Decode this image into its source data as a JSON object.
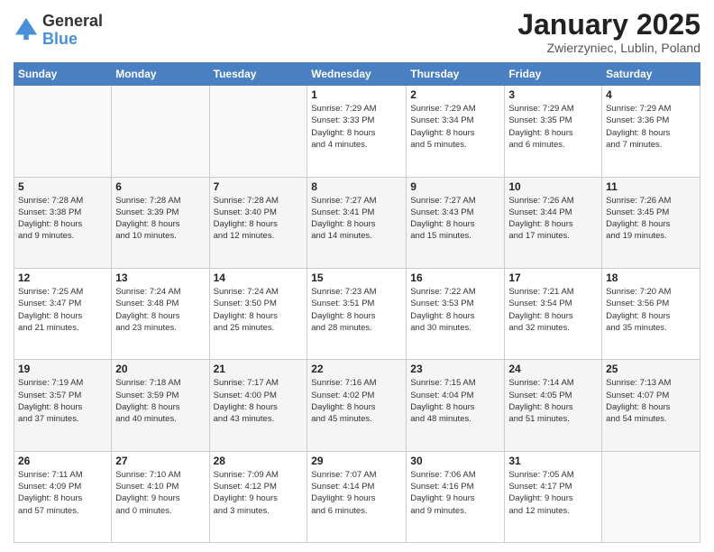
{
  "logo": {
    "general": "General",
    "blue": "Blue"
  },
  "header": {
    "title": "January 2025",
    "subtitle": "Zwierzyniec, Lublin, Poland"
  },
  "days": [
    "Sunday",
    "Monday",
    "Tuesday",
    "Wednesday",
    "Thursday",
    "Friday",
    "Saturday"
  ],
  "weeks": [
    [
      {
        "num": "",
        "info": ""
      },
      {
        "num": "",
        "info": ""
      },
      {
        "num": "",
        "info": ""
      },
      {
        "num": "1",
        "info": "Sunrise: 7:29 AM\nSunset: 3:33 PM\nDaylight: 8 hours\nand 4 minutes."
      },
      {
        "num": "2",
        "info": "Sunrise: 7:29 AM\nSunset: 3:34 PM\nDaylight: 8 hours\nand 5 minutes."
      },
      {
        "num": "3",
        "info": "Sunrise: 7:29 AM\nSunset: 3:35 PM\nDaylight: 8 hours\nand 6 minutes."
      },
      {
        "num": "4",
        "info": "Sunrise: 7:29 AM\nSunset: 3:36 PM\nDaylight: 8 hours\nand 7 minutes."
      }
    ],
    [
      {
        "num": "5",
        "info": "Sunrise: 7:28 AM\nSunset: 3:38 PM\nDaylight: 8 hours\nand 9 minutes."
      },
      {
        "num": "6",
        "info": "Sunrise: 7:28 AM\nSunset: 3:39 PM\nDaylight: 8 hours\nand 10 minutes."
      },
      {
        "num": "7",
        "info": "Sunrise: 7:28 AM\nSunset: 3:40 PM\nDaylight: 8 hours\nand 12 minutes."
      },
      {
        "num": "8",
        "info": "Sunrise: 7:27 AM\nSunset: 3:41 PM\nDaylight: 8 hours\nand 14 minutes."
      },
      {
        "num": "9",
        "info": "Sunrise: 7:27 AM\nSunset: 3:43 PM\nDaylight: 8 hours\nand 15 minutes."
      },
      {
        "num": "10",
        "info": "Sunrise: 7:26 AM\nSunset: 3:44 PM\nDaylight: 8 hours\nand 17 minutes."
      },
      {
        "num": "11",
        "info": "Sunrise: 7:26 AM\nSunset: 3:45 PM\nDaylight: 8 hours\nand 19 minutes."
      }
    ],
    [
      {
        "num": "12",
        "info": "Sunrise: 7:25 AM\nSunset: 3:47 PM\nDaylight: 8 hours\nand 21 minutes."
      },
      {
        "num": "13",
        "info": "Sunrise: 7:24 AM\nSunset: 3:48 PM\nDaylight: 8 hours\nand 23 minutes."
      },
      {
        "num": "14",
        "info": "Sunrise: 7:24 AM\nSunset: 3:50 PM\nDaylight: 8 hours\nand 25 minutes."
      },
      {
        "num": "15",
        "info": "Sunrise: 7:23 AM\nSunset: 3:51 PM\nDaylight: 8 hours\nand 28 minutes."
      },
      {
        "num": "16",
        "info": "Sunrise: 7:22 AM\nSunset: 3:53 PM\nDaylight: 8 hours\nand 30 minutes."
      },
      {
        "num": "17",
        "info": "Sunrise: 7:21 AM\nSunset: 3:54 PM\nDaylight: 8 hours\nand 32 minutes."
      },
      {
        "num": "18",
        "info": "Sunrise: 7:20 AM\nSunset: 3:56 PM\nDaylight: 8 hours\nand 35 minutes."
      }
    ],
    [
      {
        "num": "19",
        "info": "Sunrise: 7:19 AM\nSunset: 3:57 PM\nDaylight: 8 hours\nand 37 minutes."
      },
      {
        "num": "20",
        "info": "Sunrise: 7:18 AM\nSunset: 3:59 PM\nDaylight: 8 hours\nand 40 minutes."
      },
      {
        "num": "21",
        "info": "Sunrise: 7:17 AM\nSunset: 4:00 PM\nDaylight: 8 hours\nand 43 minutes."
      },
      {
        "num": "22",
        "info": "Sunrise: 7:16 AM\nSunset: 4:02 PM\nDaylight: 8 hours\nand 45 minutes."
      },
      {
        "num": "23",
        "info": "Sunrise: 7:15 AM\nSunset: 4:04 PM\nDaylight: 8 hours\nand 48 minutes."
      },
      {
        "num": "24",
        "info": "Sunrise: 7:14 AM\nSunset: 4:05 PM\nDaylight: 8 hours\nand 51 minutes."
      },
      {
        "num": "25",
        "info": "Sunrise: 7:13 AM\nSunset: 4:07 PM\nDaylight: 8 hours\nand 54 minutes."
      }
    ],
    [
      {
        "num": "26",
        "info": "Sunrise: 7:11 AM\nSunset: 4:09 PM\nDaylight: 8 hours\nand 57 minutes."
      },
      {
        "num": "27",
        "info": "Sunrise: 7:10 AM\nSunset: 4:10 PM\nDaylight: 9 hours\nand 0 minutes."
      },
      {
        "num": "28",
        "info": "Sunrise: 7:09 AM\nSunset: 4:12 PM\nDaylight: 9 hours\nand 3 minutes."
      },
      {
        "num": "29",
        "info": "Sunrise: 7:07 AM\nSunset: 4:14 PM\nDaylight: 9 hours\nand 6 minutes."
      },
      {
        "num": "30",
        "info": "Sunrise: 7:06 AM\nSunset: 4:16 PM\nDaylight: 9 hours\nand 9 minutes."
      },
      {
        "num": "31",
        "info": "Sunrise: 7:05 AM\nSunset: 4:17 PM\nDaylight: 9 hours\nand 12 minutes."
      },
      {
        "num": "",
        "info": ""
      }
    ]
  ]
}
